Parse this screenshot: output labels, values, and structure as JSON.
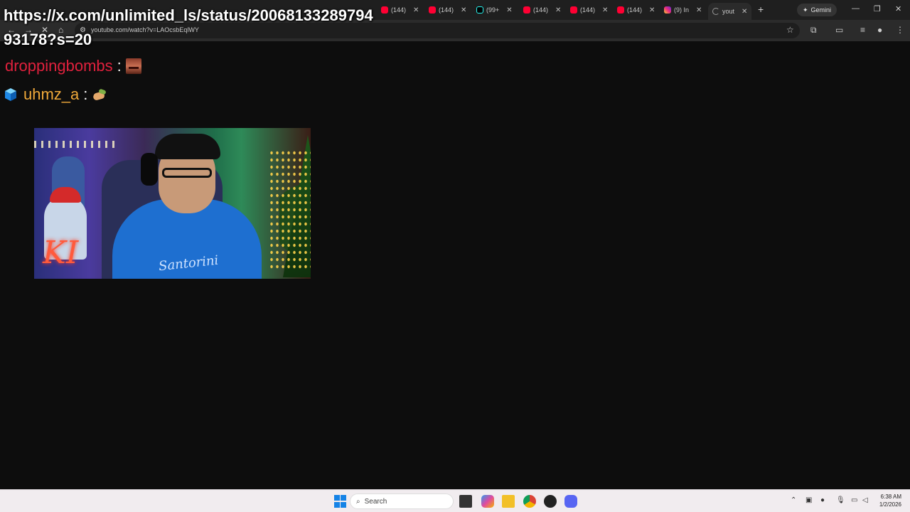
{
  "overlay": {
    "url_text": "https://x.com/unlimited_ls/status/2006813328979493178?s=20"
  },
  "browser": {
    "tabs": [
      {
        "label": "(144)",
        "favicon": "youtube-icon"
      },
      {
        "label": "(144)",
        "favicon": "youtube-icon"
      },
      {
        "label": "(99+",
        "favicon": "tiktok-icon"
      },
      {
        "label": "(144)",
        "favicon": "youtube-icon"
      },
      {
        "label": "(144)",
        "favicon": "youtube-icon"
      },
      {
        "label": "(144)",
        "favicon": "youtube-icon"
      },
      {
        "label": "(9) In",
        "favicon": "instagram-icon"
      },
      {
        "label": "yout",
        "favicon": "loading-icon"
      }
    ],
    "gemini_label": "Gemini",
    "address": "youtube.com/watch?v=LAOcsbEqlWY"
  },
  "chat": [
    {
      "username": "droppingbombs",
      "colon": ":",
      "emote": "face-emote"
    },
    {
      "username": "uhmz_a",
      "colon": ":",
      "emote": "hand-emote",
      "badge": "cube-badge"
    }
  ],
  "video": {
    "neon_text": "KI"
  },
  "taskbar": {
    "search_placeholder": "Search",
    "time": "6:38 AM",
    "date": "1/2/2026"
  },
  "colors": {
    "user1": "#e0213d",
    "user2": "#f0a93a",
    "background": "#0d0d0d"
  }
}
